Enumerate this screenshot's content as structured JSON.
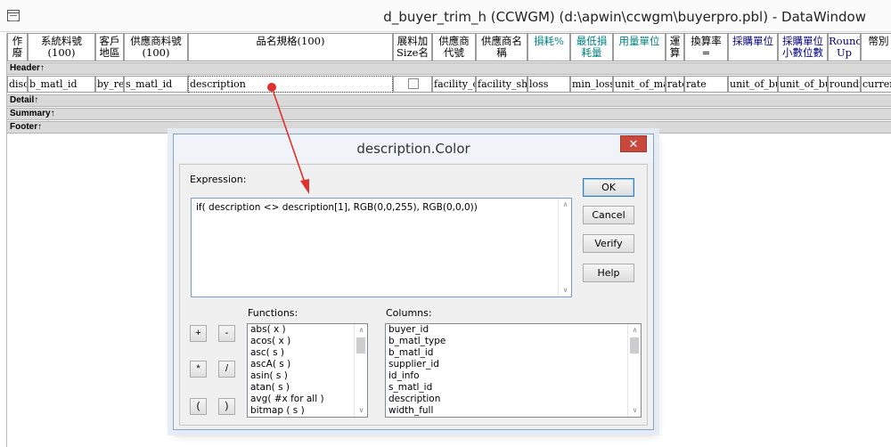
{
  "window": {
    "title": "d_buyer_trim_h  (CCWGM) (d:\\apwin\\ccwgm\\buyerpro.pbl) - DataWindow"
  },
  "painter": {
    "header_columns": [
      {
        "label": "作\n廢",
        "color": "black"
      },
      {
        "label": "系統料號\n(100)",
        "color": "black"
      },
      {
        "label": "客戶\n地區",
        "color": "black"
      },
      {
        "label": "供應商料號\n(100)",
        "color": "black"
      },
      {
        "label": "品名規格(100)",
        "color": "black"
      },
      {
        "label": "展料加\nSize名",
        "color": "black"
      },
      {
        "label": "供應商\n代號",
        "color": "black"
      },
      {
        "label": "供應商名\n稱",
        "color": "black"
      },
      {
        "label": "損耗%",
        "color": "teal"
      },
      {
        "label": "最低損\n耗量",
        "color": "teal"
      },
      {
        "label": "用量單位",
        "color": "teal"
      },
      {
        "label": "運\n算",
        "color": "black"
      },
      {
        "label": "換算率\n=",
        "color": "black"
      },
      {
        "label": "採購單位",
        "color": "navy"
      },
      {
        "label": "採購單位\n小數位數",
        "color": "navy"
      },
      {
        "label": "Round\nUp",
        "color": "navy"
      },
      {
        "label": "幣別",
        "color": "black"
      }
    ],
    "detail_columns": [
      "disc",
      "b_matl_id",
      "by_reg",
      "s_matl_id",
      "description",
      "",
      "facility_cd",
      "facility_sho",
      "loss",
      "min_loss",
      "unit_of_mat",
      "rate",
      "rate",
      "unit_of_buy",
      "unit_of_buy",
      "roundu",
      "currenc"
    ],
    "bands": {
      "header": "Header↑",
      "detail": "Detail↑",
      "summary": "Summary↑",
      "footer": "Footer↑"
    }
  },
  "dialog": {
    "title": "description.Color",
    "expression_label": "Expression:",
    "expression_value": "if( description <> description[1], RGB(0,0,255), RGB(0,0,0))",
    "buttons": {
      "ok": "OK",
      "cancel": "Cancel",
      "verify": "Verify",
      "help": "Help"
    },
    "operators": [
      "+",
      "-",
      "*",
      "/",
      "(",
      ")"
    ],
    "functions_label": "Functions:",
    "functions": [
      "abs( x )",
      "acos( x )",
      "asc( s )",
      "ascA( s )",
      "asin( s )",
      "atan( s )",
      "avg( #x for all )",
      "bitmap ( s )"
    ],
    "columns_label": "Columns:",
    "columns": [
      "buyer_id",
      "b_matl_type",
      "b_matl_id",
      "supplier_id",
      "id_info",
      "s_matl_id",
      "description",
      "width_full"
    ]
  },
  "colors": {
    "annotation_arrow": "#e03030",
    "teal_header": "#008080",
    "navy_header": "#000080"
  }
}
